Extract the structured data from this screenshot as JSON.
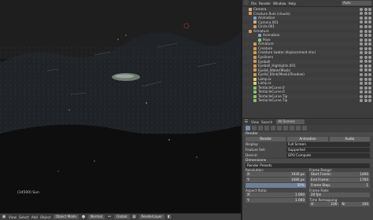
{
  "viewport": {
    "status_text": "(14500) Sun",
    "header": {
      "view": "View",
      "select": "Select",
      "add": "Add",
      "object": "Object",
      "mode": "Object Mode",
      "shading": "Normal",
      "global": "Global",
      "render_layer": "RenderLayer"
    }
  },
  "info_bar": {
    "menus": [
      "File",
      "Render",
      "Window",
      "Help"
    ],
    "field": "Auto"
  },
  "outliner": {
    "rows": [
      {
        "label": "Camera",
        "indent": 1,
        "color": "#c9b27a"
      },
      {
        "label": "Creature Rule (clouds)",
        "indent": 1,
        "color": "#d39a4a"
      },
      {
        "label": "Animation",
        "indent": 2,
        "color": "#7aa0c9"
      },
      {
        "label": "Camera.001",
        "indent": 2,
        "color": "#c9b27a"
      },
      {
        "label": "Circle.001",
        "indent": 2,
        "color": "#d39a4a"
      },
      {
        "label": "Armature",
        "indent": 1,
        "color": "#d39a4a"
      },
      {
        "label": "Animation",
        "indent": 3,
        "color": "#7aa0c9"
      },
      {
        "label": "Pose",
        "indent": 3,
        "color": "#8fbf6a"
      },
      {
        "label": "Armature",
        "indent": 2,
        "color": "#d39a4a"
      },
      {
        "label": "Creature",
        "indent": 2,
        "color": "#d39a4a"
      },
      {
        "label": "Creature (water displacement shn)",
        "indent": 2,
        "color": "#d39a4a"
      },
      {
        "label": "Eyeliners",
        "indent": 2,
        "color": "#d39a4a"
      },
      {
        "label": "Eyeball",
        "indent": 2,
        "color": "#d39a4a"
      },
      {
        "label": "Eyeball_Highlights.001",
        "indent": 2,
        "color": "#d39a4a"
      },
      {
        "label": "Eyelid_Water(Mask)",
        "indent": 2,
        "color": "#d39a4a"
      },
      {
        "label": "Eyelid_Blink(Mask)(Shadow)",
        "indent": 2,
        "color": "#d39a4a"
      },
      {
        "label": "Lamp.ix",
        "indent": 2,
        "color": "#e0d06a"
      },
      {
        "label": "Lamp.ix",
        "indent": 2,
        "color": "#e0d06a"
      },
      {
        "label": "TentacleCurve.0",
        "indent": 2,
        "color": "#8fbf6a"
      },
      {
        "label": "TentacleCurve.0",
        "indent": 2,
        "color": "#8fbf6a"
      },
      {
        "label": "TentacleCurve.Tip",
        "indent": 2,
        "color": "#8fbf6a"
      },
      {
        "label": "TentacleCurve.Tip",
        "indent": 2,
        "color": "#8fbf6a"
      }
    ],
    "footer": {
      "view": "View",
      "search": "Search",
      "filter": "All Scenes"
    }
  },
  "properties": {
    "render_header": "Render",
    "render_buttons": [
      "Render",
      "Animation",
      "Audio"
    ],
    "display_label": "Display:",
    "display_value": "Full Screen",
    "feature_label": "Feature Set:",
    "feature_value": "Supported",
    "device_label": "Device:",
    "device_value": "GPU Compute",
    "dimensions_header": "Dimensions",
    "presets": "Render Presets",
    "resolution_label": "Resolution:",
    "res_x": "1920 px",
    "res_y": "1080 px",
    "res_pct": "50%",
    "frame_range_label": "Frame Range:",
    "start": "1400",
    "end": "1700",
    "step": "1",
    "aspect_label": "Aspect Ratio:",
    "aspect_x": "1.000",
    "aspect_y": "1.000",
    "frame_rate_label": "Frame Rate:",
    "frame_rate": "24 fps",
    "time_remap": "Time Remapping:",
    "old": "100",
    "new": "100"
  }
}
